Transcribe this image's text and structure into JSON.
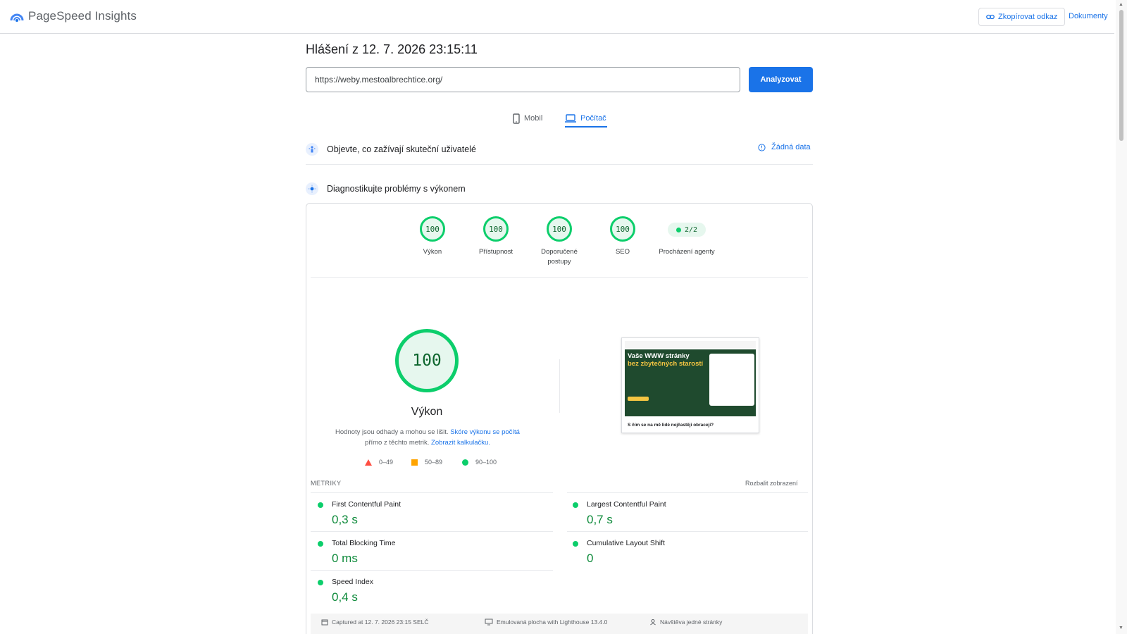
{
  "app": {
    "name": "PageSpeed Insights",
    "copy_link_label": "Zkopírovat odkaz",
    "docs_label": "Dokumenty"
  },
  "report": {
    "title": "Hlášení z 12. 7. 2026 23:15:11",
    "url": "https://weby.mestoalbrechtice.org/",
    "analyze_label": "Analyzovat"
  },
  "tabs": [
    {
      "label": "Mobil",
      "icon": "phone-icon",
      "active": false
    },
    {
      "label": "Počítač",
      "icon": "laptop-icon",
      "active": true
    }
  ],
  "real_users": {
    "title": "Objevte, co zažívají skuteční uživatelé",
    "no_data_label": "Žádná data"
  },
  "diagnostics": {
    "title": "Diagnostikujte problémy s výkonem"
  },
  "categories": [
    {
      "score": "100",
      "label": "Výkon"
    },
    {
      "score": "100",
      "label": "Přístupnost"
    },
    {
      "score": "100",
      "label": "Doporučené postupy"
    },
    {
      "score": "100",
      "label": "SEO"
    }
  ],
  "agent": {
    "value": "2/2",
    "label": "Procházení agenty"
  },
  "performance": {
    "score": "100",
    "title": "Výkon",
    "desc_part1": "Hodnoty jsou odhady a mohou se lišit. ",
    "desc_link1": "Skóre výkonu se počítá",
    "desc_part2": " přímo z těchto metrik. ",
    "desc_link2": "Zobrazit kalkulačku."
  },
  "legend": [
    {
      "range": "0–49",
      "color": "#ff4e42",
      "shape": "triangle"
    },
    {
      "range": "50–89",
      "color": "#ffa400",
      "shape": "square"
    },
    {
      "range": "90–100",
      "color": "#0cce6b",
      "shape": "circle"
    }
  ],
  "thumbnail": {
    "headline1": "Vaše WWW stránky",
    "headline2": "bez zbytečných starostí",
    "question": "S čím se na mě lidé nejčastěji obracejí?"
  },
  "metrics": {
    "header": "METRIKY",
    "expand_label": "Rozbalit zobrazení",
    "items": [
      {
        "name": "First Contentful Paint",
        "value": "0,3 s"
      },
      {
        "name": "Largest Contentful Paint",
        "value": "0,7 s"
      },
      {
        "name": "Total Blocking Time",
        "value": "0 ms"
      },
      {
        "name": "Cumulative Layout Shift",
        "value": "0"
      },
      {
        "name": "Speed Index",
        "value": "0,4 s"
      }
    ]
  },
  "footer": {
    "captured": "Captured at 12. 7. 2026 23:15 SELČ",
    "emulated": "Emulovaná plocha with Lighthouse 13.4.0",
    "visit": "Návštěva jedné stránky"
  },
  "colors": {
    "accent": "#1a73e8",
    "pass": "#0cce6b",
    "pass_text": "#0d652d"
  }
}
